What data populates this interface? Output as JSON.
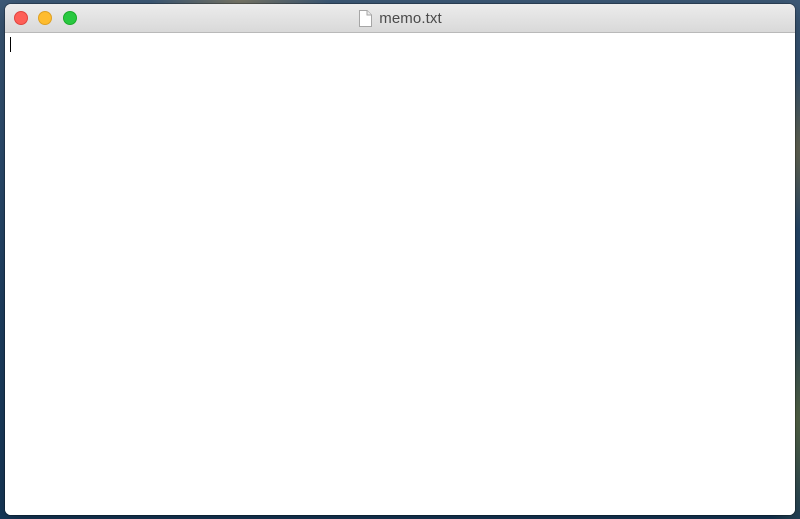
{
  "window": {
    "title": "memo.txt",
    "title_icon": "document-icon",
    "controls": {
      "close": "close-button",
      "minimize": "minimize-button",
      "zoom": "zoom-button"
    }
  },
  "editor": {
    "content": "",
    "cursor_visible": true
  },
  "colors": {
    "close": "#fe5f57",
    "minimize": "#febc2e",
    "zoom": "#28c840",
    "titlebar": "#e3e3e3",
    "editor_background": "#ffffff"
  }
}
